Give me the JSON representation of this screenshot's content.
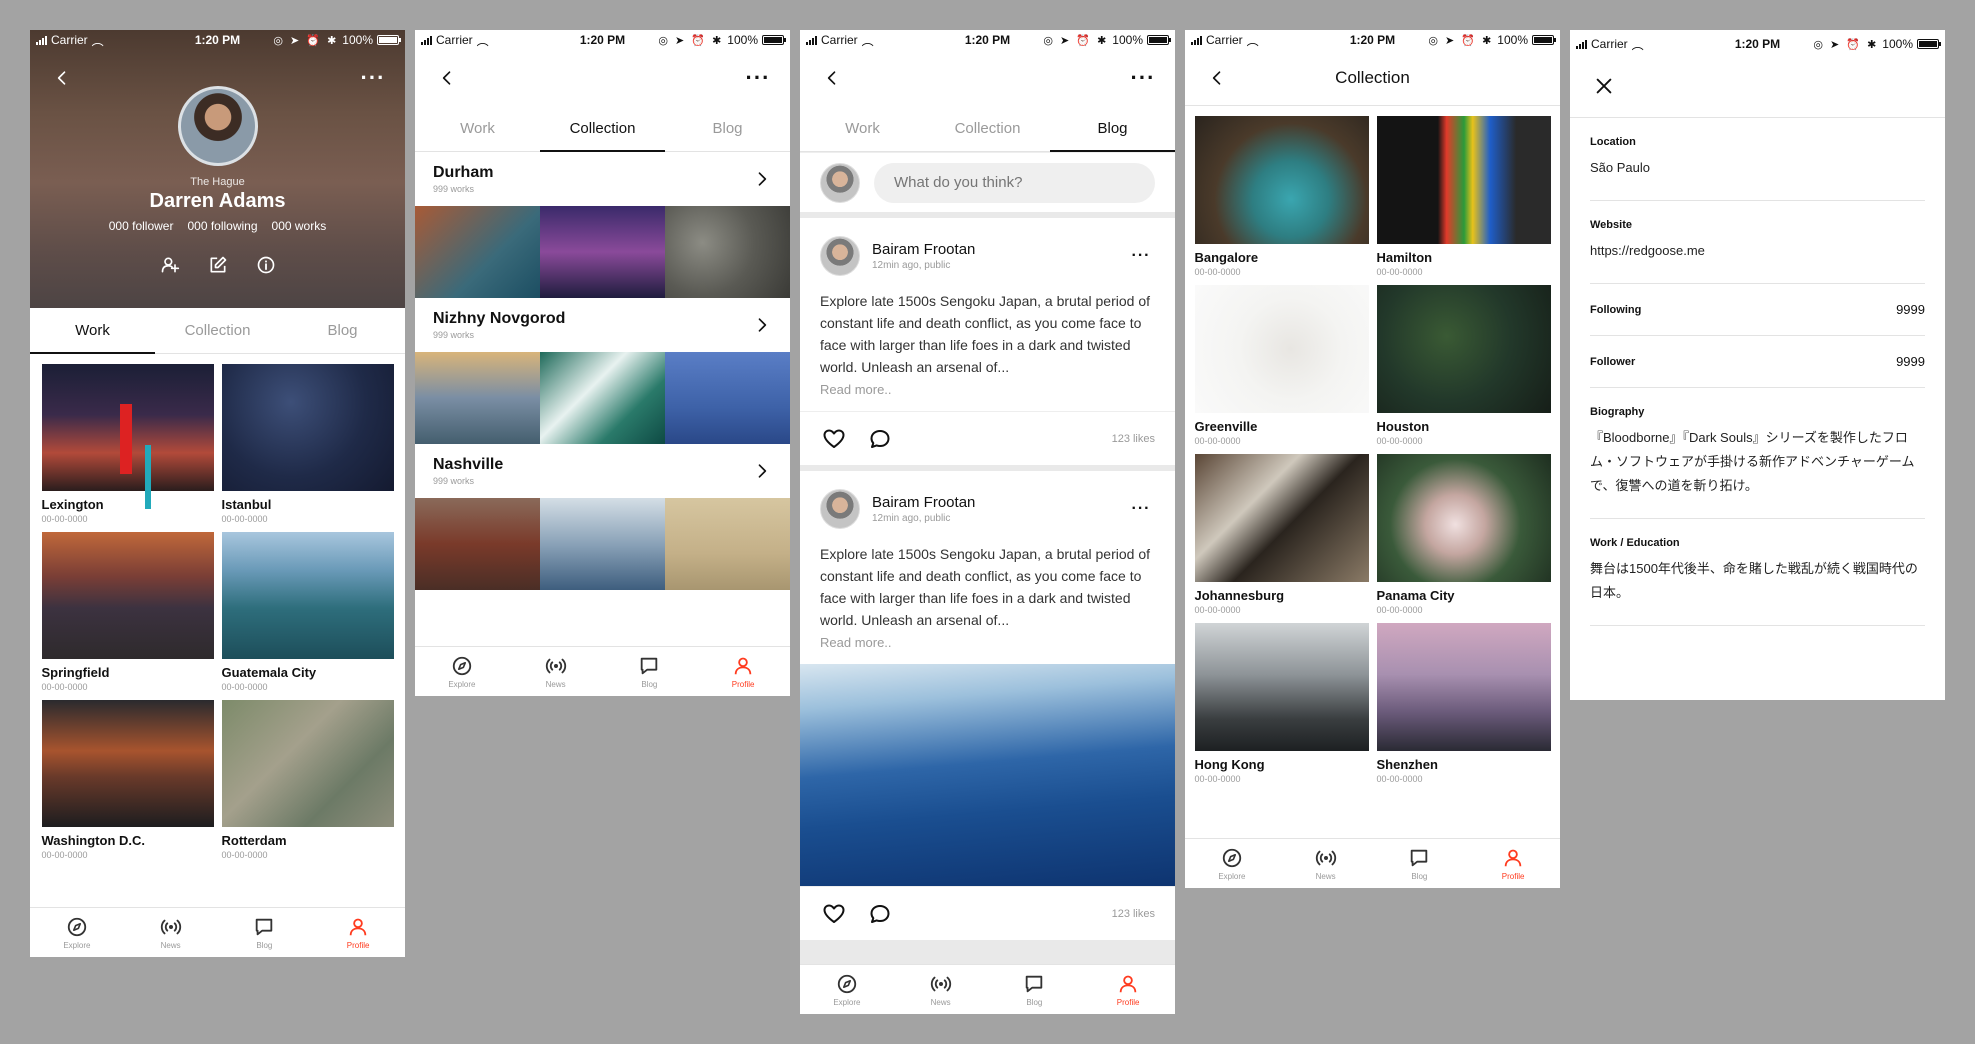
{
  "status": {
    "carrier": "Carrier",
    "time": "1:20 PM",
    "battery": "100%",
    "icons": "◎ ➤ ⏰ ✱"
  },
  "tabbar": {
    "explore": "Explore",
    "news": "News",
    "blog": "Blog",
    "profile": "Profile"
  },
  "tabs": {
    "work": "Work",
    "collection": "Collection",
    "blog": "Blog"
  },
  "profile": {
    "city": "The Hague",
    "name": "Darren Adams",
    "followers": "000 follower",
    "following": "000 following",
    "works": "000 works",
    "items": [
      {
        "title": "Lexington",
        "date": "00-00-0000",
        "image": "lighthouse"
      },
      {
        "title": "Istanbul",
        "date": "00-00-0000",
        "image": "istanbul"
      },
      {
        "title": "Springfield",
        "date": "00-00-0000",
        "image": "springfield"
      },
      {
        "title": "Guatemala City",
        "date": "00-00-0000",
        "image": "guatemala"
      },
      {
        "title": "Washington D.C.",
        "date": "00-00-0000",
        "image": "washington"
      },
      {
        "title": "Rotterdam",
        "date": "00-00-0000",
        "image": "rotterdam"
      }
    ]
  },
  "collections": [
    {
      "name": "Durham",
      "works": "999 works"
    },
    {
      "name": "Nizhny Novgorod",
      "works": "999 works"
    },
    {
      "name": "Nashville",
      "works": "999 works"
    }
  ],
  "blog": {
    "compose_placeholder": "What do you think?",
    "posts": [
      {
        "author": "Bairam Frootan",
        "time": "12min ago, public",
        "text": "Explore late 1500s Sengoku Japan, a brutal period of constant life and death conflict, as you come face to face with larger than life foes in a dark and twisted world. Unleash an arsenal of...",
        "read_more": "Read more..",
        "likes": "123 likes"
      },
      {
        "author": "Bairam Frootan",
        "time": "12min ago, public",
        "text": "Explore late 1500s Sengoku Japan, a brutal period of constant life and death conflict, as you come face to face with larger than life foes in a dark and twisted world. Unleash an arsenal of...",
        "read_more": "Read more..",
        "likes": "123 likes"
      }
    ]
  },
  "collection_screen": {
    "title": "Collection",
    "items": [
      {
        "title": "Bangalore",
        "date": "00-00-0000"
      },
      {
        "title": "Hamilton",
        "date": "00-00-0000"
      },
      {
        "title": "Greenville",
        "date": "00-00-0000"
      },
      {
        "title": "Houston",
        "date": "00-00-0000"
      },
      {
        "title": "Johannesburg",
        "date": "00-00-0000"
      },
      {
        "title": "Panama City",
        "date": "00-00-0000"
      },
      {
        "title": "Hong Kong",
        "date": "00-00-0000"
      },
      {
        "title": "Shenzhen",
        "date": "00-00-0000"
      }
    ]
  },
  "info": {
    "location_label": "Location",
    "location": "São Paulo",
    "website_label": "Website",
    "website": "https://redgoose.me",
    "following_label": "Following",
    "following": "9999",
    "follower_label": "Follower",
    "follower": "9999",
    "biography_label": "Biography",
    "biography": "『Bloodborne』『Dark Souls』シリーズを製作したフロム・ソフトウェアが手掛ける新作アドベンチャーゲームで、復讐への道を斬り拓け。",
    "work_label": "Work / Education",
    "work": "舞台は1500年代後半、命を賭した戦乱が続く戦国時代の日本。"
  },
  "colors": {
    "accent": "#ff3b1f",
    "background": "#a3a3a3"
  }
}
